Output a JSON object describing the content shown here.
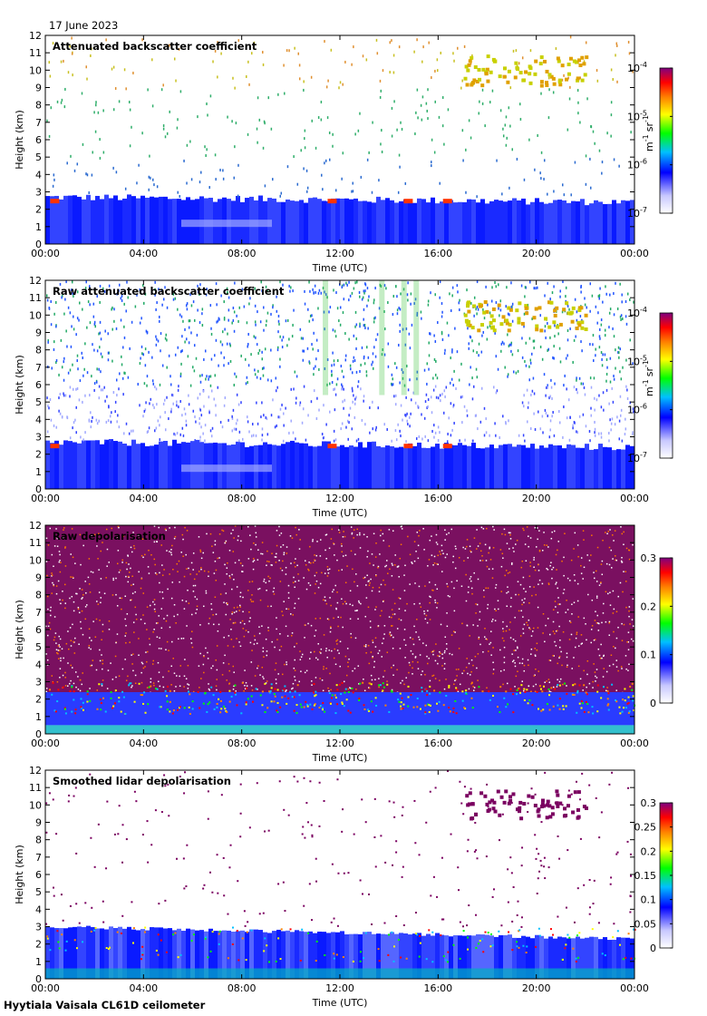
{
  "date": "17 June 2023",
  "footer": "Hyytiala Vaisala CL61D ceilometer",
  "colors": {
    "colormap": [
      "#ffffff",
      "#c8c8ff",
      "#0000ff",
      "#00c0ff",
      "#00ff00",
      "#ffff00",
      "#ff8000",
      "#ff0000",
      "#800080"
    ],
    "blue": "#2233ff",
    "purple": "#7a0060"
  },
  "chart_data": [
    {
      "type": "heatmap",
      "title": "Attenuated backscatter coefficient",
      "xlabel": "Time (UTC)",
      "ylabel": "Height (km)",
      "x_ticks": [
        "00:00",
        "04:00",
        "08:00",
        "12:00",
        "16:00",
        "20:00",
        "00:00"
      ],
      "y_ticks": [
        0,
        1,
        2,
        3,
        4,
        5,
        6,
        7,
        8,
        9,
        10,
        11,
        12
      ],
      "xlim_hours": [
        0,
        24
      ],
      "ylim_km": [
        0,
        12
      ],
      "colorbar": {
        "scale": "log",
        "range": [
          1e-07,
          0.0001
        ],
        "tick_labels": [
          {
            "base": "10",
            "exp": "-4"
          },
          {
            "base": "10",
            "exp": "-5"
          },
          {
            "base": "10",
            "exp": "-6"
          },
          {
            "base": "10",
            "exp": "-7"
          }
        ],
        "unit": {
          "m": "m",
          "m_exp": "-1",
          "sr": "sr",
          "sr_exp": "-1"
        }
      },
      "features": {
        "boundary_layer_top_km": 2.8,
        "cirrus": {
          "start_h": 17,
          "end_h": 22,
          "base_km": 9.2,
          "top_km": 10.9
        }
      }
    },
    {
      "type": "heatmap",
      "title": "Raw attenuated backscatter coefficient",
      "xlabel": "Time (UTC)",
      "ylabel": "Height (km)",
      "x_ticks": [
        "00:00",
        "04:00",
        "08:00",
        "12:00",
        "16:00",
        "20:00",
        "00:00"
      ],
      "y_ticks": [
        0,
        1,
        2,
        3,
        4,
        5,
        6,
        7,
        8,
        9,
        10,
        11,
        12
      ],
      "xlim_hours": [
        0,
        24
      ],
      "ylim_km": [
        0,
        12
      ],
      "colorbar": {
        "scale": "log",
        "range": [
          1e-07,
          0.0001
        ],
        "tick_labels": [
          {
            "base": "10",
            "exp": "-4"
          },
          {
            "base": "10",
            "exp": "-5"
          },
          {
            "base": "10",
            "exp": "-6"
          },
          {
            "base": "10",
            "exp": "-7"
          }
        ],
        "unit": {
          "m": "m",
          "m_exp": "-1",
          "sr": "sr",
          "sr_exp": "-1"
        }
      },
      "features": {
        "boundary_layer_top_km": 2.8,
        "cirrus": {
          "start_h": 17,
          "end_h": 22,
          "base_km": 9.2,
          "top_km": 10.9
        }
      }
    },
    {
      "type": "heatmap",
      "title": "Raw depolarisation",
      "xlabel": "Time (UTC)",
      "ylabel": "Height (km)",
      "x_ticks": [
        "00:00",
        "04:00",
        "08:00",
        "12:00",
        "16:00",
        "20:00",
        "00:00"
      ],
      "y_ticks": [
        0,
        1,
        2,
        3,
        4,
        5,
        6,
        7,
        8,
        9,
        10,
        11,
        12
      ],
      "xlim_hours": [
        0,
        24
      ],
      "ylim_km": [
        0,
        12
      ],
      "colorbar": {
        "scale": "linear",
        "range": [
          0,
          0.3
        ],
        "tick_labels": [
          "0.3",
          "0.2",
          "0.1",
          "0"
        ]
      }
    },
    {
      "type": "heatmap",
      "title": "Smoothed lidar depolarisation",
      "xlabel": "Time (UTC)",
      "ylabel": "Height (km)",
      "x_ticks": [
        "00:00",
        "04:00",
        "08:00",
        "12:00",
        "16:00",
        "20:00",
        "00:00"
      ],
      "y_ticks": [
        0,
        1,
        2,
        3,
        4,
        5,
        6,
        7,
        8,
        9,
        10,
        11,
        12
      ],
      "xlim_hours": [
        0,
        24
      ],
      "ylim_km": [
        0,
        12
      ],
      "colorbar": {
        "scale": "linear",
        "range": [
          0,
          0.3
        ],
        "tick_labels": [
          "0.3",
          "0.25",
          "0.2",
          "0.15",
          "0.1",
          "0.05",
          "0"
        ]
      }
    }
  ]
}
